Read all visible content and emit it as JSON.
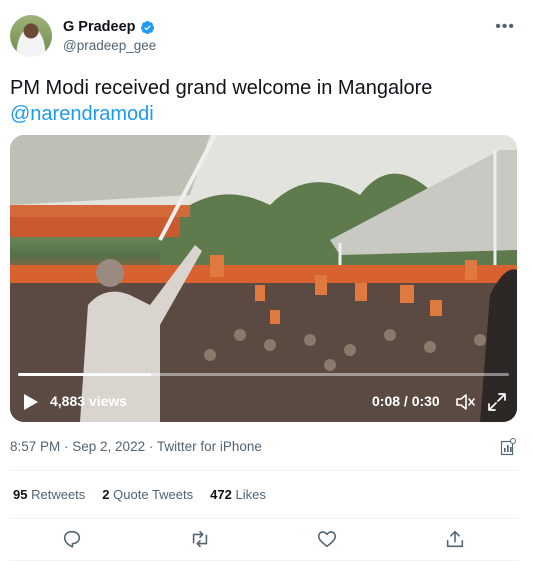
{
  "author": {
    "name": "G Pradeep",
    "handle": "@pradeep_gee",
    "verified": true
  },
  "tweet": {
    "text": "PM Modi received grand welcome in Mangalore",
    "mention": "@narendramodi"
  },
  "video": {
    "views": "4,883 views",
    "time": "0:08 / 0:30",
    "progress": 0.27
  },
  "meta": {
    "timestamp": "8:57 PM · Sep 2, 2022",
    "separator": "·",
    "source": "Twitter for iPhone"
  },
  "stats": {
    "retweets_count": "95",
    "retweets_label": "Retweets",
    "quotes_count": "2",
    "quotes_label": "Quote Tweets",
    "likes_count": "472",
    "likes_label": "Likes"
  },
  "colors": {
    "link": "#1d9bf0",
    "secondary_text": "#536471",
    "primary_text": "#0f1419"
  },
  "icons": [
    "more-icon",
    "verified-badge-icon",
    "play-icon",
    "mute-icon",
    "expand-icon",
    "analytics-icon",
    "reply-icon",
    "retweet-icon",
    "like-icon",
    "share-icon"
  ]
}
